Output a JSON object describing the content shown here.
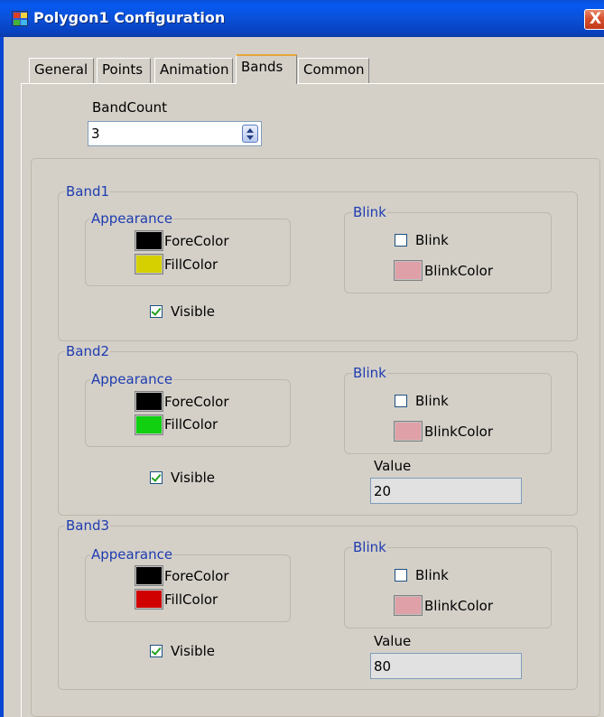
{
  "window": {
    "title": "Polygon1 Configuration",
    "close_glyph": "X"
  },
  "tabs": [
    {
      "label": "General",
      "active": false
    },
    {
      "label": "Points",
      "active": false
    },
    {
      "label": "Animation",
      "active": false
    },
    {
      "label": "Bands",
      "active": true
    },
    {
      "label": "Common",
      "active": false
    }
  ],
  "band_count": {
    "label": "BandCount",
    "value": "3"
  },
  "bands": [
    {
      "title": "Band1",
      "appearance": {
        "title": "Appearance",
        "fore_label": "ForeColor",
        "fore_color": "#000000",
        "fill_label": "FillColor",
        "fill_color": "#d6d000"
      },
      "blink": {
        "title": "Blink",
        "blink_label": "Blink",
        "blink_checked": false,
        "blink_color_label": "BlinkColor",
        "blink_color": "#e0a0a8"
      },
      "visible": {
        "label": "Visible",
        "checked": true
      }
    },
    {
      "title": "Band2",
      "appearance": {
        "title": "Appearance",
        "fore_label": "ForeColor",
        "fore_color": "#000000",
        "fill_label": "FillColor",
        "fill_color": "#10d010"
      },
      "blink": {
        "title": "Blink",
        "blink_label": "Blink",
        "blink_checked": false,
        "blink_color_label": "BlinkColor",
        "blink_color": "#e0a0a8"
      },
      "visible": {
        "label": "Visible",
        "checked": true
      },
      "value": {
        "label": "Value",
        "value": "20"
      }
    },
    {
      "title": "Band3",
      "appearance": {
        "title": "Appearance",
        "fore_label": "ForeColor",
        "fore_color": "#000000",
        "fill_label": "FillColor",
        "fill_color": "#d00000"
      },
      "blink": {
        "title": "Blink",
        "blink_label": "Blink",
        "blink_checked": false,
        "blink_color_label": "BlinkColor",
        "blink_color": "#e0a0a8"
      },
      "visible": {
        "label": "Visible",
        "checked": true
      },
      "value": {
        "label": "Value",
        "value": "80"
      }
    }
  ],
  "icons": {
    "app": "app-window-icon",
    "close": "close-icon",
    "spin": "spin-updown-icon"
  }
}
